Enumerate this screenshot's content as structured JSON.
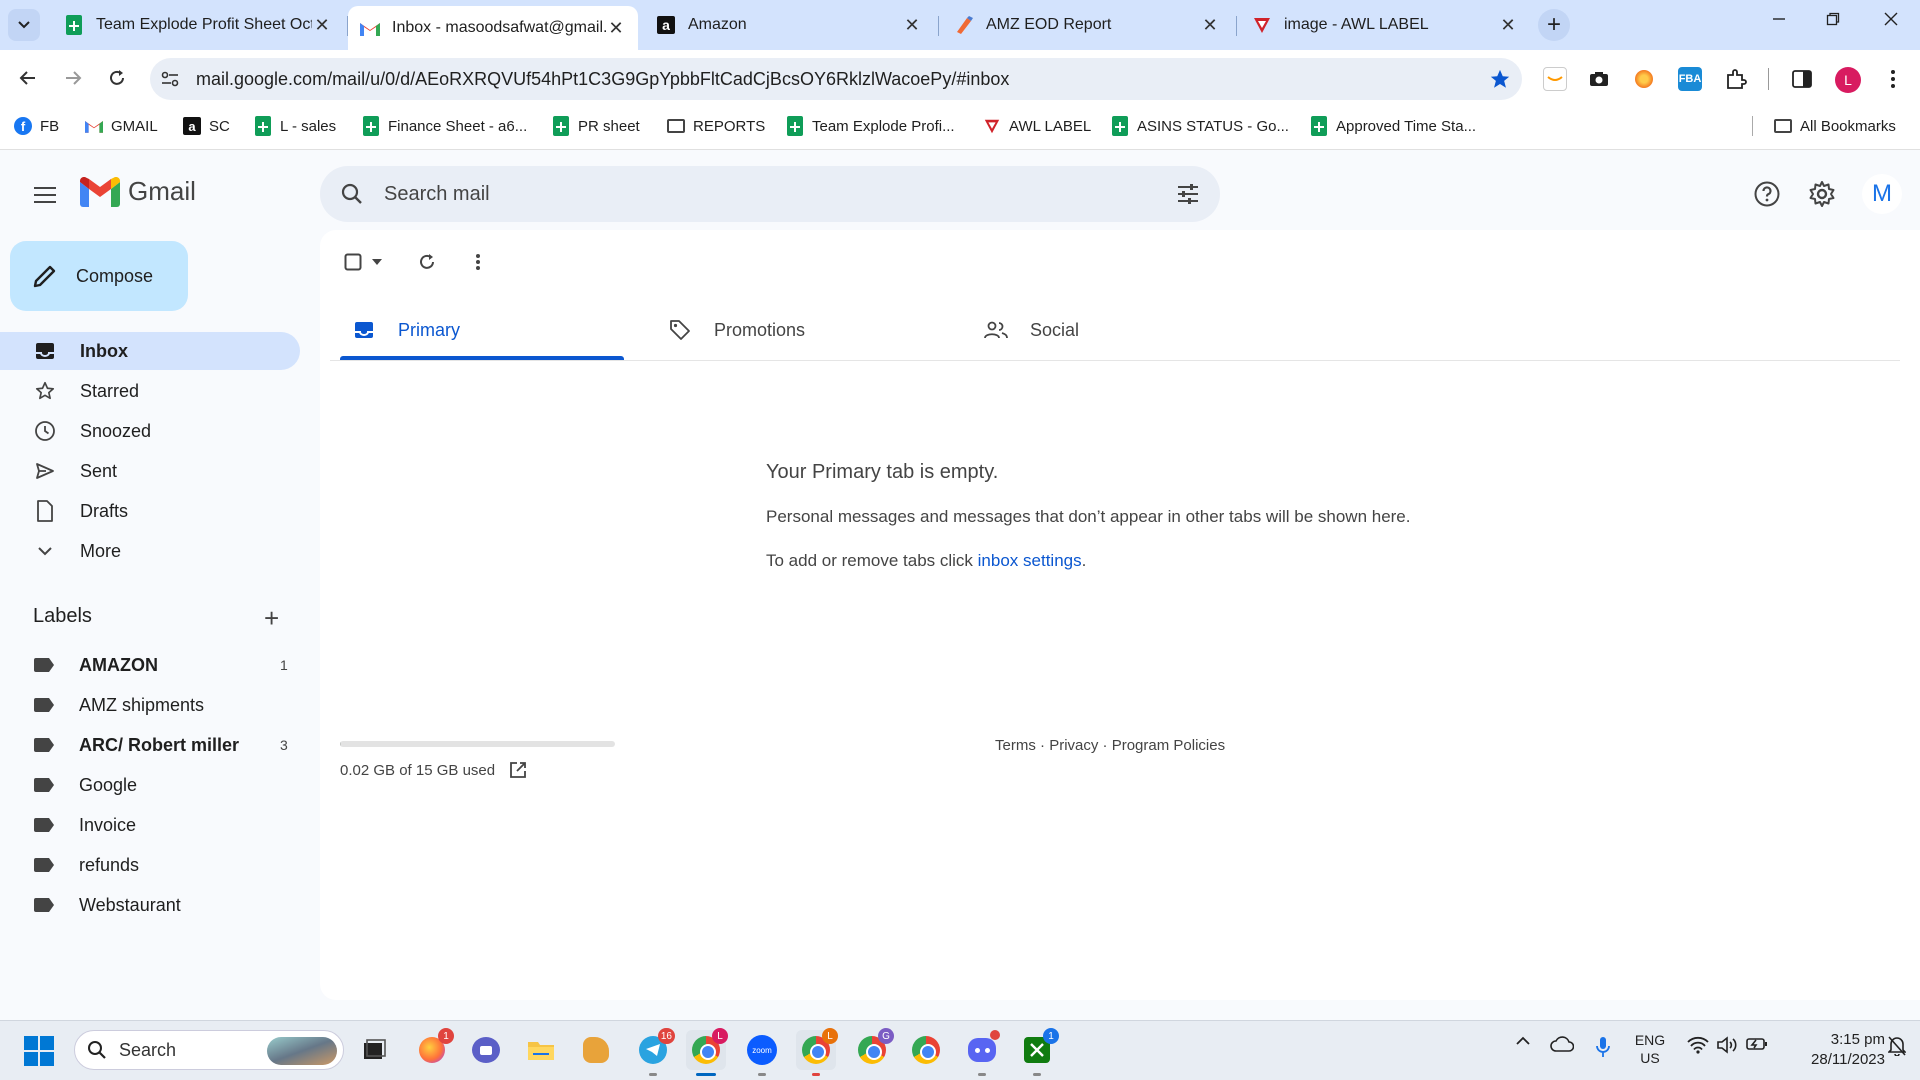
{
  "browser": {
    "tabs": [
      {
        "title": "Team Explode Profit Sheet Oct",
        "icon": "sheets-icon"
      },
      {
        "title": "Inbox - masoodsafwat@gmail.",
        "icon": "gmail-icon",
        "active": true
      },
      {
        "title": "Amazon",
        "icon": "amazon-icon"
      },
      {
        "title": "AMZ EOD Report",
        "icon": "pen-app-icon"
      },
      {
        "title": "image - AWL LABEL",
        "icon": "awl-icon"
      }
    ],
    "close_glyph": "✕",
    "new_tab_glyph": "+",
    "url": "mail.google.com/mail/u/0/d/AEoRXRQVUf54hPt1C3G9GpYpbbFltCadCjBcsOY6RklzlWacoePy/#inbox",
    "profile_initial": "L",
    "bookmarks": [
      {
        "label": "FB",
        "icon": "facebook-icon"
      },
      {
        "label": "GMAIL",
        "icon": "gmail-icon"
      },
      {
        "label": "SC",
        "icon": "amazon-icon"
      },
      {
        "label": "L - sales",
        "icon": "sheets-icon"
      },
      {
        "label": "Finance Sheet - a6...",
        "icon": "sheets-icon"
      },
      {
        "label": "PR sheet",
        "icon": "sheets-icon"
      },
      {
        "label": "REPORTS",
        "icon": "folder-icon"
      },
      {
        "label": "Team Explode Profi...",
        "icon": "sheets-icon"
      },
      {
        "label": "AWL LABEL",
        "icon": "awl-icon"
      },
      {
        "label": "ASINS STATUS - Go...",
        "icon": "sheets-icon"
      },
      {
        "label": "Approved Time Sta...",
        "icon": "sheets-icon"
      }
    ],
    "all_bookmarks": "All Bookmarks",
    "ext_fba": "FBA"
  },
  "gmail": {
    "product_name": "Gmail",
    "search_placeholder": "Search mail",
    "avatar_initial": "M",
    "compose_label": "Compose",
    "nav": [
      {
        "label": "Inbox",
        "icon": "inbox-icon",
        "active": true
      },
      {
        "label": "Starred",
        "icon": "star-icon"
      },
      {
        "label": "Snoozed",
        "icon": "clock-icon"
      },
      {
        "label": "Sent",
        "icon": "send-icon"
      },
      {
        "label": "Drafts",
        "icon": "draft-icon"
      },
      {
        "label": "More",
        "icon": "chevron-down-icon"
      }
    ],
    "labels_heading": "Labels",
    "labels_add": "+",
    "labels": [
      {
        "name": "AMAZON",
        "count": "1",
        "bold": true
      },
      {
        "name": "AMZ shipments",
        "count": ""
      },
      {
        "name": "ARC/ Robert miller",
        "count": "3",
        "bold": true
      },
      {
        "name": "Google",
        "count": ""
      },
      {
        "name": "Invoice",
        "count": ""
      },
      {
        "name": "refunds",
        "count": ""
      },
      {
        "name": "Webstaurant",
        "count": ""
      }
    ],
    "inbox_tabs": [
      {
        "label": "Primary",
        "icon": "inbox-icon",
        "active": true
      },
      {
        "label": "Promotions",
        "icon": "tag-icon"
      },
      {
        "label": "Social",
        "icon": "people-icon"
      }
    ],
    "empty": {
      "title": "Your Primary tab is empty.",
      "line1": "Personal messages and messages that don’t appear in other tabs will be shown here.",
      "line2_prefix": "To add or remove tabs click ",
      "line2_link": "inbox settings",
      "line2_suffix": "."
    },
    "storage": {
      "text": "0.02 GB of 15 GB used",
      "used_fraction": 0.0013
    },
    "footer": {
      "terms": "Terms",
      "privacy": "Privacy",
      "policies": "Program Policies",
      "sep": " · "
    }
  },
  "taskbar": {
    "search_label": "Search",
    "lang_line1": "ENG",
    "lang_line2": "US",
    "time": "3:15 pm",
    "date": "28/11/2023",
    "badges": {
      "firefox": "1",
      "telegram": "16",
      "chrome1": "L",
      "chrome2": "L",
      "chrome3": "G",
      "xbox": "1"
    }
  },
  "colors": {
    "accent": "#0b57d0",
    "compose": "#c2e7ff",
    "nav_active": "#d3e3fd",
    "tabstrip": "#d3e3fd"
  }
}
